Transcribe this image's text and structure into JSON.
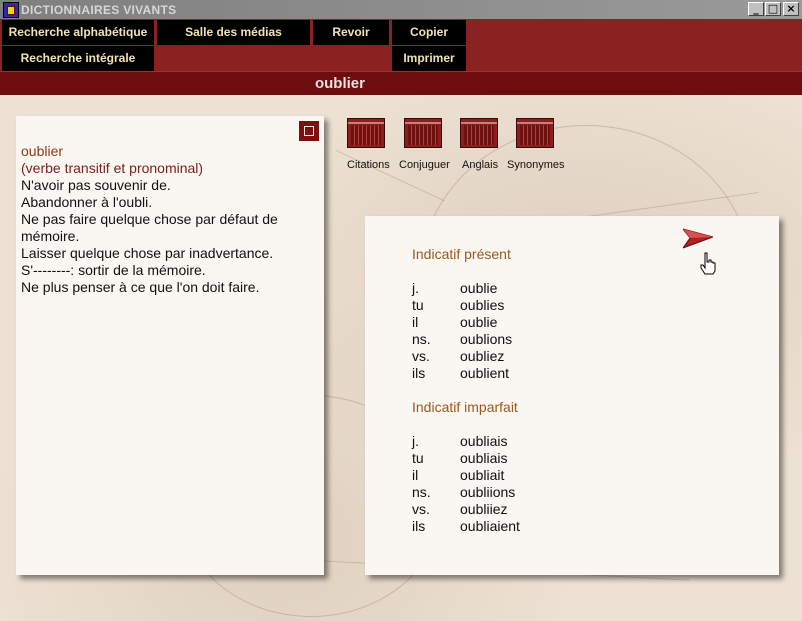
{
  "window": {
    "title": "DICTIONNAIRES VIVANTS",
    "btn_min": "_",
    "btn_max": "□",
    "btn_close": "×"
  },
  "menu": {
    "recherche_alpha": "Recherche alphabétique",
    "salle_medias": "Salle des médias",
    "revoir": "Revoir",
    "copier": "Copier",
    "recherche_integrale": "Recherche intégrale",
    "imprimer": "Imprimer"
  },
  "word": "oublier",
  "definition": {
    "headword": "oublier",
    "category": "(verbe transitif et pronominal)",
    "lines": [
      "N'avoir pas souvenir de.",
      "Abandonner à l'oubli.",
      "Ne pas faire quelque chose par défaut de",
      "mémoire.",
      "Laisser quelque chose par inadvertance.",
      "S'--------: sortir de la mémoire.",
      "Ne plus penser à ce que l'on doit faire."
    ]
  },
  "tools": [
    {
      "label": "Citations"
    },
    {
      "label": "Conjuguer"
    },
    {
      "label": "Anglais"
    },
    {
      "label": "Synonymes"
    }
  ],
  "conjugation": [
    {
      "title": "Indicatif présent",
      "rows": [
        [
          "j.",
          "oublie"
        ],
        [
          "tu",
          "oublies"
        ],
        [
          "il",
          "oublie"
        ],
        [
          "ns.",
          "oublions"
        ],
        [
          "vs.",
          "oubliez"
        ],
        [
          "ils",
          "oublient"
        ]
      ]
    },
    {
      "title": "Indicatif imparfait",
      "rows": [
        [
          "j.",
          "oubliais"
        ],
        [
          "tu",
          "oubliais"
        ],
        [
          "il",
          "oubliait"
        ],
        [
          "ns.",
          "oubliions"
        ],
        [
          "vs.",
          "oubliiez"
        ],
        [
          "ils",
          "oubliaient"
        ]
      ]
    }
  ],
  "colors": {
    "menu_bg": "#8b2222",
    "button_bg": "#000000",
    "button_text": "#f0e2b6",
    "section_title": "#9a5a1e"
  }
}
